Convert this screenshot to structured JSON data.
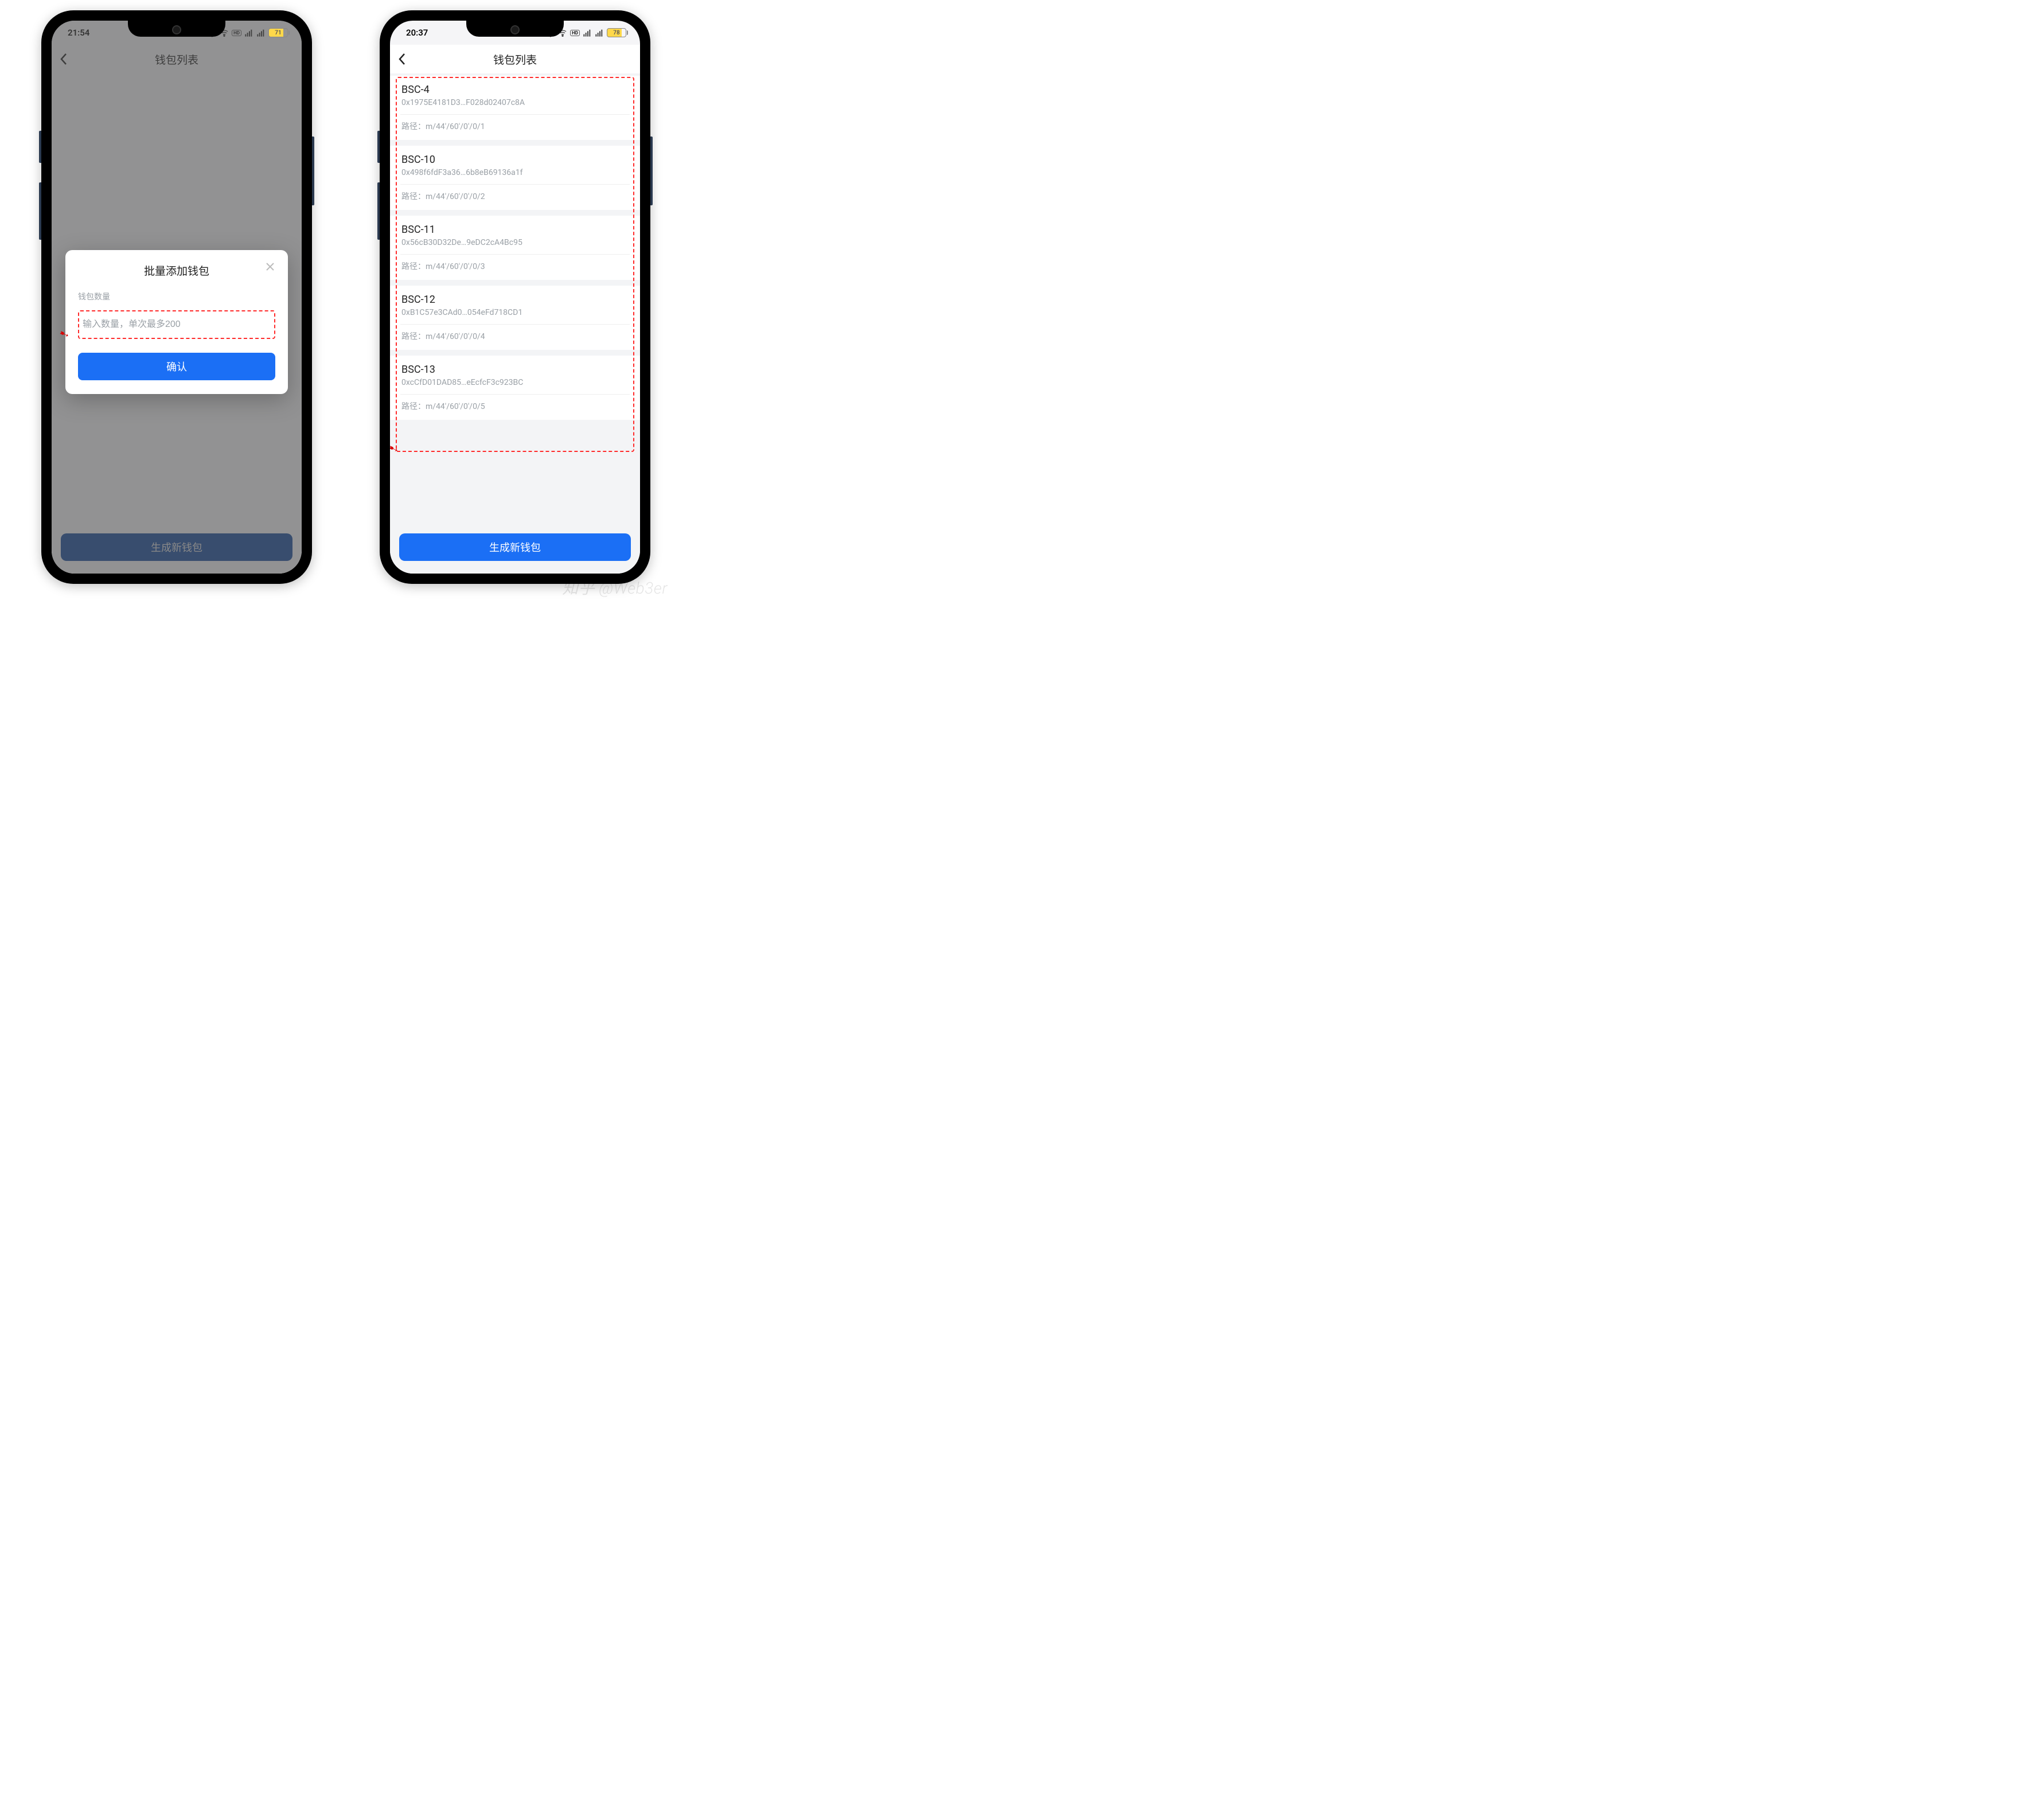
{
  "watermark": "知乎 @Web3er",
  "left": {
    "status": {
      "time": "21:54",
      "battery": "71"
    },
    "header": {
      "title": "钱包列表"
    },
    "gen_button": "生成新钱包",
    "modal": {
      "title": "批量添加钱包",
      "label": "钱包数量",
      "placeholder": "输入数量，单次最多200",
      "confirm": "确认"
    }
  },
  "right": {
    "status": {
      "time": "20:37",
      "battery": "78"
    },
    "header": {
      "title": "钱包列表"
    },
    "gen_button": "生成新钱包",
    "path_prefix": "路径：",
    "wallets": [
      {
        "name": "BSC-4",
        "addr": "0x1975E4181D3…F028d02407c8A",
        "path": "m/44'/60'/0'/0/1"
      },
      {
        "name": "BSC-10",
        "addr": "0x498f6fdF3a36…6b8eB69136a1f",
        "path": "m/44'/60'/0'/0/2"
      },
      {
        "name": "BSC-11",
        "addr": "0x56cB30D32De…9eDC2cA4Bc95",
        "path": "m/44'/60'/0'/0/3"
      },
      {
        "name": "BSC-12",
        "addr": "0xB1C57e3CAd0…054eFd718CD1",
        "path": "m/44'/60'/0'/0/4"
      },
      {
        "name": "BSC-13",
        "addr": "0xcCfD01DAD85…eEcfcF3c923BC",
        "path": "m/44'/60'/0'/0/5"
      }
    ]
  },
  "colors": {
    "primary": "#1b6ff5",
    "highlight": "#ff2a2a"
  }
}
